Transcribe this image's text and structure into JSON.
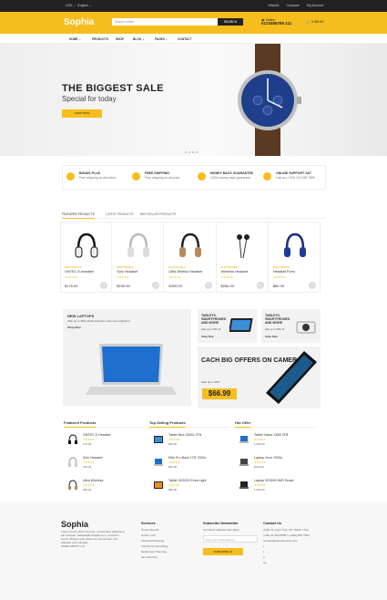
{
  "topbar": {
    "currency": "USD ⌄",
    "language": "English ⌄",
    "wishlist": "Wishlist",
    "compare": "Compare",
    "account": "My Account"
  },
  "header": {
    "logo": "Sophia",
    "search_placeholder": "Search entire",
    "search_button": "SEARCH",
    "hotline_label": "Hotline:",
    "hotline": "0123456789 111",
    "cart_count": "0",
    "cart_price": "$0.00"
  },
  "nav": [
    "HOME ⌄",
    "PRODUCTS",
    "SHOP",
    "BLOG ⌄",
    "PAGES ⌄",
    "CONTACT"
  ],
  "hero": {
    "title": "THE BIGGEST SALE",
    "subtitle": "Special for today",
    "button": "SHOP NOW"
  },
  "features": [
    {
      "title": "BONUS PLUS",
      "text": "Free shipping on all orders"
    },
    {
      "title": "FREE SHIPPING",
      "text": "Free shipping on all order"
    },
    {
      "title": "MONEY BACK GUARANTEE",
      "text": "100% money back guarantee"
    },
    {
      "title": "ONLINE SUPPORT 24/7",
      "text": "Call us (+123) 123 456 7890"
    }
  ],
  "tabs": [
    "FEATURED PRODUCTS",
    "LATEST PRODUCTS",
    "BESTSELLER PRODUCTS"
  ],
  "products": [
    {
      "category": "ELECTRONICS",
      "name": "ONTEC E-headset",
      "stars": "★★★★★",
      "price": "$175.00"
    },
    {
      "category": "ELECTRONICS",
      "name": "Solo Headset",
      "stars": "★★★★★",
      "price": "$235.00"
    },
    {
      "category": "ELECTRONICS",
      "name": "Ultra Wirelss Headset",
      "stars": "★★★★★",
      "price": "$390.00"
    },
    {
      "category": "ELECTRONICS",
      "name": "Wireless Headset",
      "stars": "★★★★★",
      "price": "$266.00"
    },
    {
      "category": "ELECTRONICS",
      "name": "Headset Porro",
      "stars": "★★★★★",
      "price": "$60.00"
    }
  ],
  "banner_laptops": {
    "title": "NEW LAPTOPS",
    "subtitle": "Sale up to 30% off all products in the new collection.",
    "link": "Shop Now"
  },
  "banner_tablets_1": {
    "title": "TABLETS, SMARTPHONES AND MORE",
    "subtitle": "Sale up to 30% off",
    "link": "Shop Now"
  },
  "banner_tablets_2": {
    "title": "TABLETS, SMARTPHONES AND MORE",
    "subtitle": "Sale up to 30% off",
    "link": "Shop Now"
  },
  "banner_cameras": {
    "title": "CACH BIG OFFERS ON CAMERAS",
    "subtitle": "Sale up to 30%",
    "price": "$66.99"
  },
  "featured": {
    "heading": "Featured Products",
    "items": [
      {
        "name": "ONTEC E-Headset",
        "stars": "★★★★★",
        "price": "175.00"
      },
      {
        "name": "Solo Headset",
        "stars": "★★★★★",
        "price": "235.00"
      },
      {
        "name": "Ultra Wireless",
        "stars": "★★★★★",
        "price": "390.00"
      }
    ]
  },
  "top_selling": {
    "heading": "Top Selling Products",
    "items": [
      {
        "name": "Tablet New 3000c 2TB",
        "stars": "★★★★★",
        "price": "$40.00"
      },
      {
        "name": "Elite Pro Book 1TB 7000c",
        "stars": "★★★★★",
        "price": "$52.00"
      },
      {
        "name": "Tablet XK3000 Extra Light",
        "stars": "★★★★★",
        "price": "$60.00"
      }
    ]
  },
  "hot_offer": {
    "heading": "Hot Offer",
    "items": [
      {
        "name": "Tablet Vision X800 3TB",
        "stars": "★★★★★",
        "price": "1,280.00"
      },
      {
        "name": "Laptop Xeon 7000c",
        "stars": "★★★★★",
        "price": "$220.00"
      },
      {
        "name": "Laptop XE5000 WiFi Smart",
        "stars": "★★★★★",
        "price": "1,280.00"
      }
    ]
  },
  "footer": {
    "logo": "Sophia",
    "about": "Lorem ipsum dolor sit amet, consectetur adipiscing elit. Aenean malesuada fringilla sem, at dictum lectus ultricies quis. Etiam eu elementum orci. Aliquam erat volutpat.",
    "about_more": "MORE ABOUT US",
    "services_heading": "Services",
    "services": [
      "Home Guards",
      "Smart Lock",
      "Financial Planning",
      "Insurance Consulting",
      "Retirement Planning",
      "Tax Planning"
    ],
    "newsletter_heading": "Subscribe Newsletter",
    "newsletter_text": "Get latest updates and offers.",
    "newsletter_placeholder": "Enter your email address",
    "newsletter_button": "SUBSCRIBE US",
    "contact_heading": "Contact Us",
    "contact": [
      "Apple St. New York, NY 10012, USA",
      "(+95) 01 324 8555 / (+202) 554 7894",
      "contact@domainname.com"
    ],
    "social": [
      "f",
      "t",
      "p",
      "G+"
    ]
  },
  "colors": {
    "accent": "#f6bd1e",
    "dark": "#222222"
  }
}
